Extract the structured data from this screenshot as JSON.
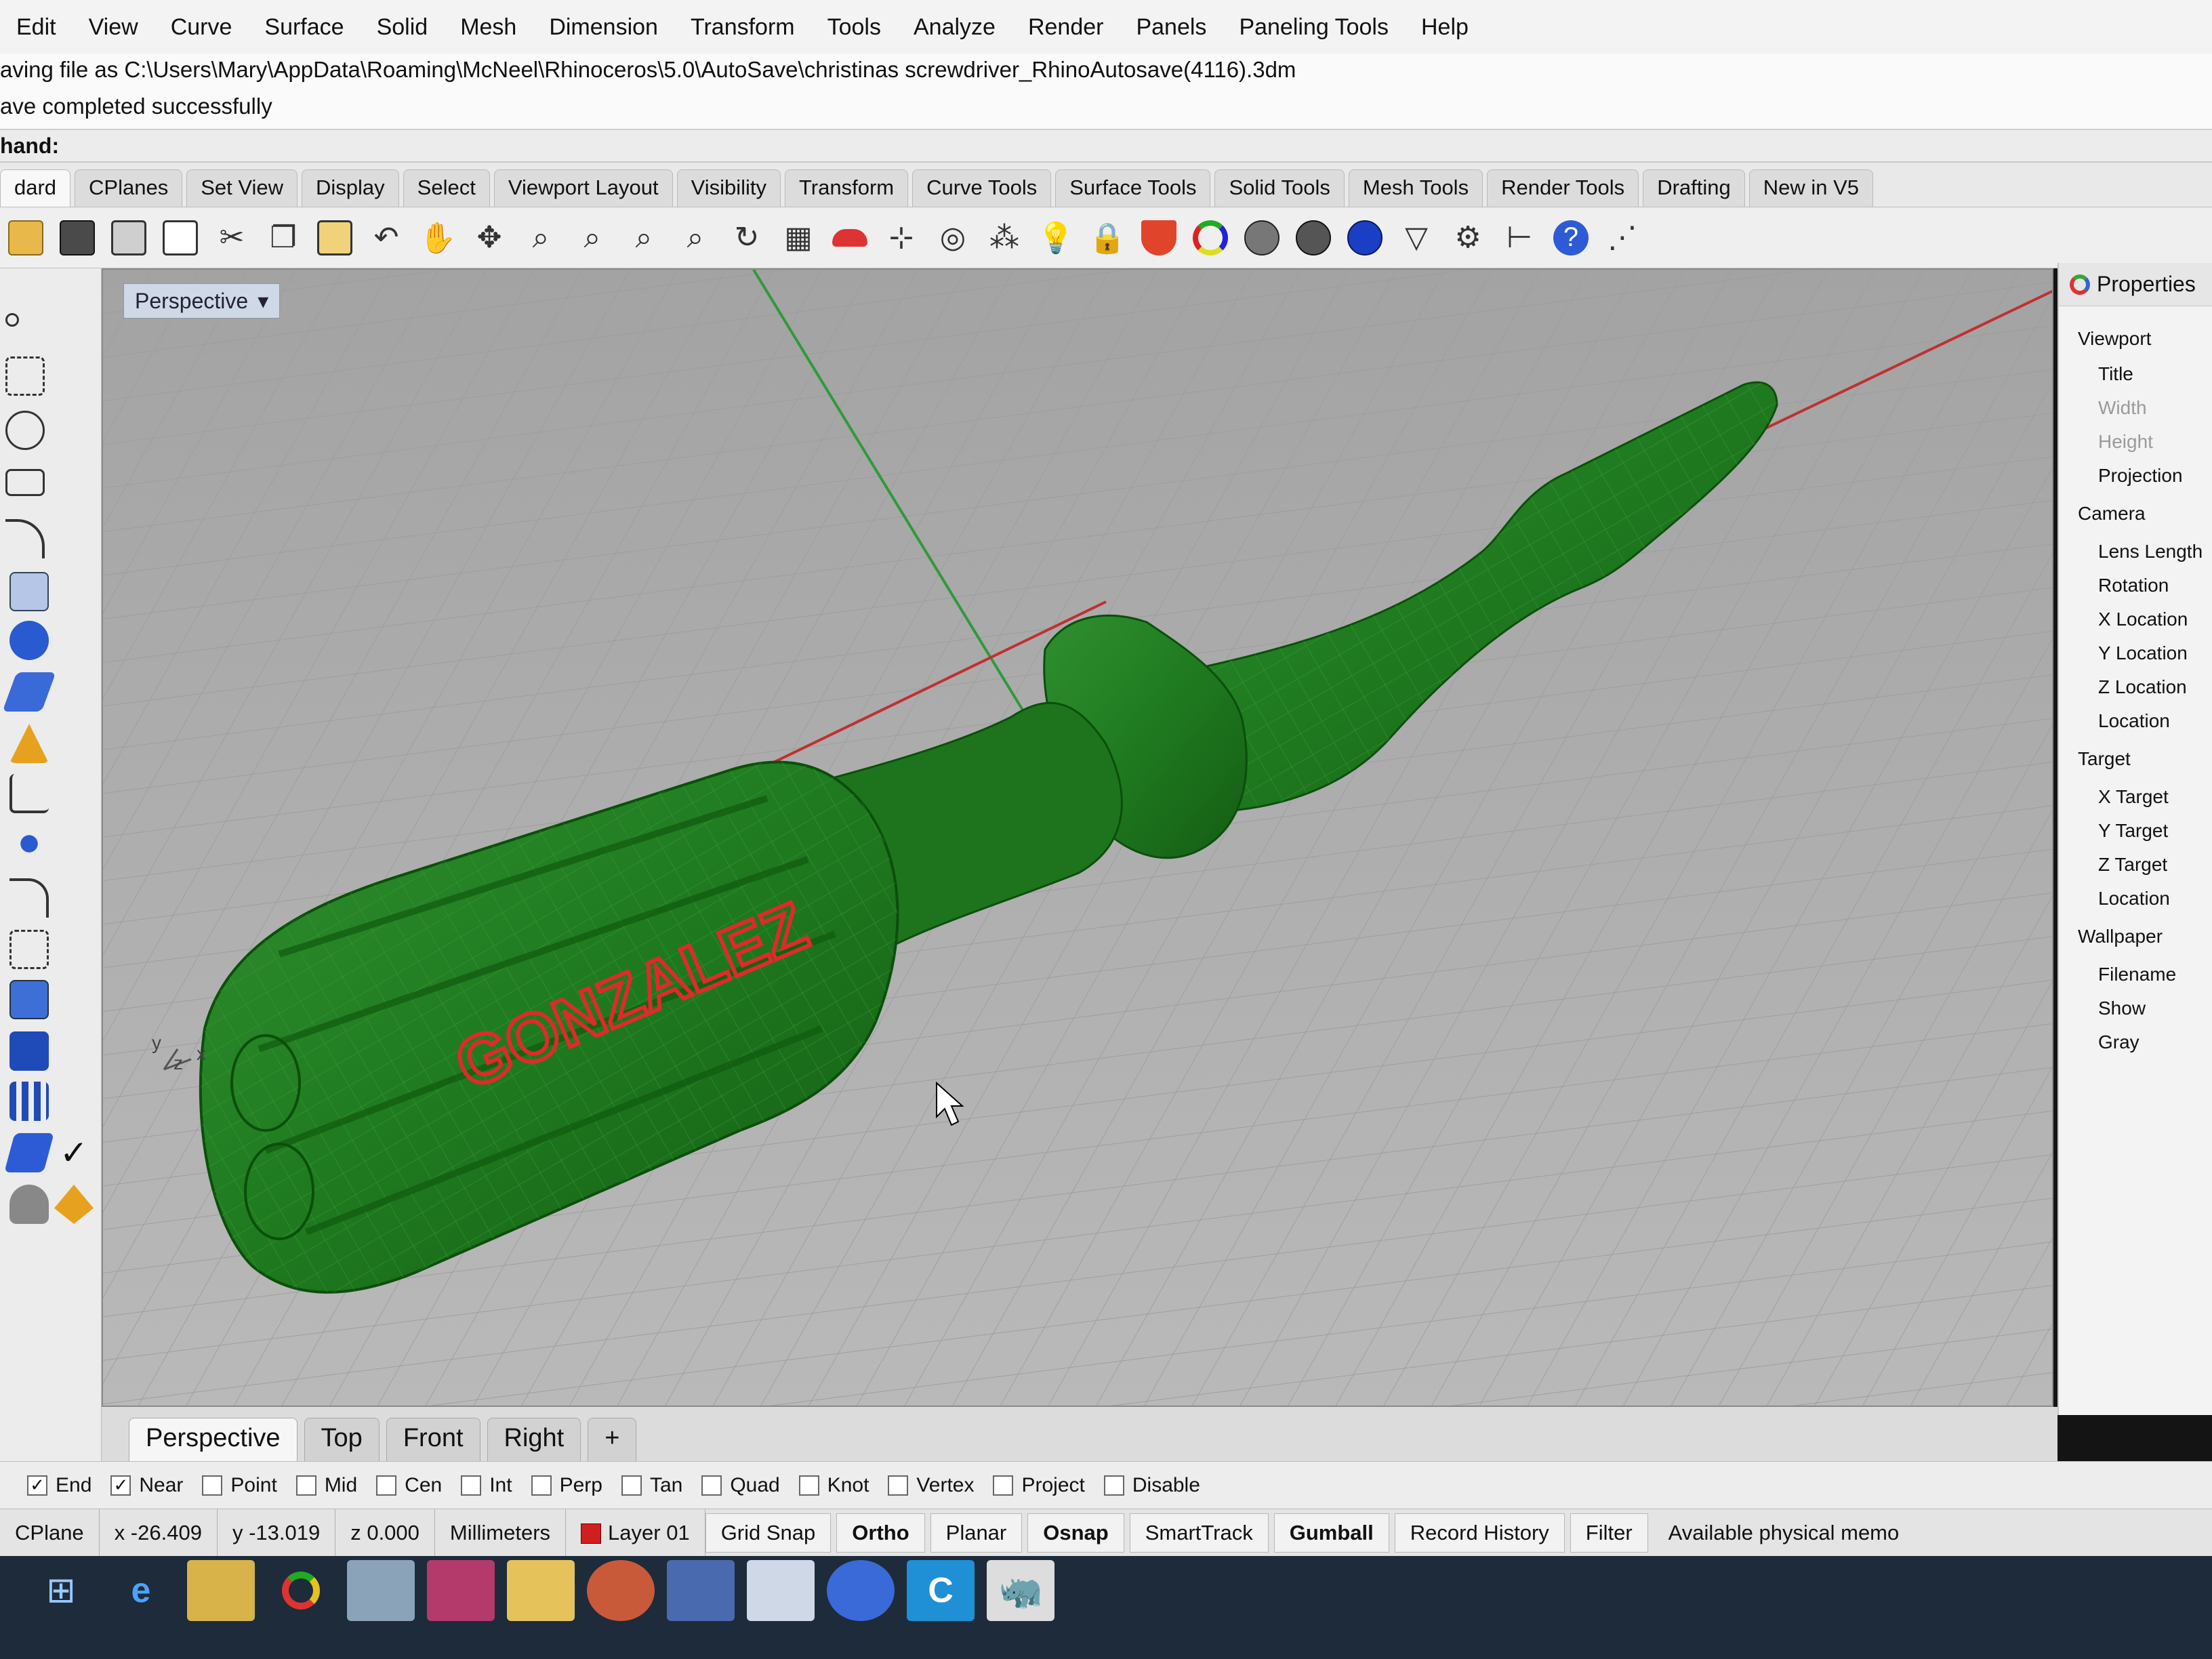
{
  "menubar": {
    "items": [
      "Edit",
      "View",
      "Curve",
      "Surface",
      "Solid",
      "Mesh",
      "Dimension",
      "Transform",
      "Tools",
      "Analyze",
      "Render",
      "Panels",
      "Paneling Tools",
      "Help"
    ]
  },
  "command_history": {
    "line1": "aving file as C:\\Users\\Mary\\AppData\\Roaming\\McNeel\\Rhinoceros\\5.0\\AutoSave\\christinas screwdriver_RhinoAutosave(4116).3dm",
    "line2": "ave completed successfully",
    "prompt": "hand:"
  },
  "toolbar_tabs": [
    "dard",
    "CPlanes",
    "Set View",
    "Display",
    "Select",
    "Viewport Layout",
    "Visibility",
    "Transform",
    "Curve Tools",
    "Surface Tools",
    "Solid Tools",
    "Mesh Tools",
    "Render Tools",
    "Drafting",
    "New in V5"
  ],
  "viewport": {
    "title": "Perspective",
    "model_text": "GONZALEZ",
    "axis_labels": {
      "y": "y",
      "z": "z",
      "x": "x"
    }
  },
  "properties": {
    "header": "Properties",
    "items": [
      {
        "label": "Viewport",
        "kind": "section"
      },
      {
        "label": "Title",
        "kind": "field"
      },
      {
        "label": "Width",
        "kind": "field-dim"
      },
      {
        "label": "Height",
        "kind": "field-dim"
      },
      {
        "label": "Projection",
        "kind": "field"
      },
      {
        "label": "Camera",
        "kind": "section"
      },
      {
        "label": "Lens Length",
        "kind": "field"
      },
      {
        "label": "Rotation",
        "kind": "field"
      },
      {
        "label": "X Location",
        "kind": "field"
      },
      {
        "label": "Y Location",
        "kind": "field"
      },
      {
        "label": "Z Location",
        "kind": "field"
      },
      {
        "label": "Location",
        "kind": "field"
      },
      {
        "label": "Target",
        "kind": "section"
      },
      {
        "label": "X Target",
        "kind": "field"
      },
      {
        "label": "Y Target",
        "kind": "field"
      },
      {
        "label": "Z Target",
        "kind": "field"
      },
      {
        "label": "Location",
        "kind": "field"
      },
      {
        "label": "Wallpaper",
        "kind": "section"
      },
      {
        "label": "Filename",
        "kind": "field"
      },
      {
        "label": "Show",
        "kind": "field"
      },
      {
        "label": "Gray",
        "kind": "field"
      }
    ]
  },
  "view_tabs": {
    "tabs": [
      "Perspective",
      "Top",
      "Front",
      "Right"
    ],
    "add": "+"
  },
  "osnaps": [
    {
      "label": "End",
      "checked": true
    },
    {
      "label": "Near",
      "checked": true
    },
    {
      "label": "Point",
      "checked": false
    },
    {
      "label": "Mid",
      "checked": false
    },
    {
      "label": "Cen",
      "checked": false
    },
    {
      "label": "Int",
      "checked": false
    },
    {
      "label": "Perp",
      "checked": false
    },
    {
      "label": "Tan",
      "checked": false
    },
    {
      "label": "Quad",
      "checked": false
    },
    {
      "label": "Knot",
      "checked": false
    },
    {
      "label": "Vertex",
      "checked": false
    },
    {
      "label": "Project",
      "checked": false
    },
    {
      "label": "Disable",
      "checked": false
    }
  ],
  "statusbar": {
    "cplane": "CPlane",
    "x": "x -26.409",
    "y": "y -13.019",
    "z": "z 0.000",
    "units": "Millimeters",
    "layer": "Layer 01",
    "buttons": [
      "Grid Snap",
      "Ortho",
      "Planar",
      "Osnap",
      "SmartTrack",
      "Gumball",
      "Record History",
      "Filter"
    ],
    "bold_buttons": [
      "Ortho",
      "Osnap",
      "Gumball"
    ],
    "memory": "Available physical memo"
  },
  "colors": {
    "model_green": "#1f7a1f",
    "model_outline": "#0b4f0b",
    "text_red": "#e02a2a",
    "viewport_bg": "#a9a9a9",
    "grid_line": "#9a9a9a",
    "axis_red": "#c03030",
    "axis_green": "#2f9a3a",
    "layer_color": "#d01f1f"
  }
}
